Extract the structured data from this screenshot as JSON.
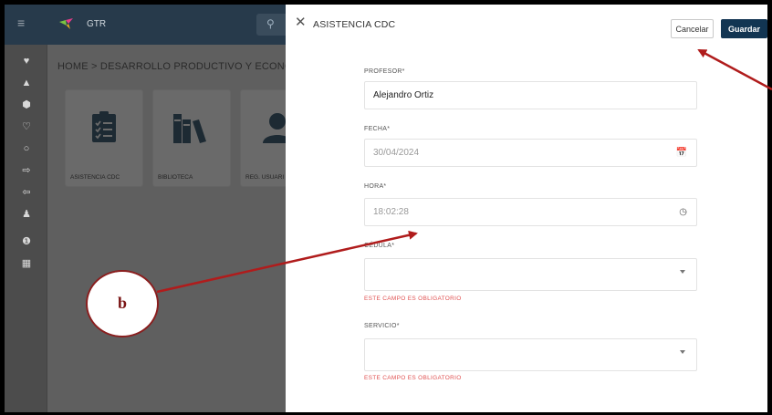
{
  "app": {
    "name": "GTR",
    "breadcrumb": "HOME  >  DESARROLLO PRODUCTIVO Y ECONC",
    "tiles": [
      {
        "label": "ASISTENCIA CDC",
        "icon": "clipboard-list-icon"
      },
      {
        "label": "BIBLIOTECA",
        "icon": "books-icon"
      },
      {
        "label": "REG. USUARI",
        "icon": "user-icon"
      }
    ],
    "rail_icons": [
      "heart-icon",
      "triangle-icon",
      "hexagon-icon",
      "bell-icon",
      "circle-icon",
      "arrow-right-icon",
      "arrow-left-icon",
      "person-icon",
      "info-icon",
      "grid-icon"
    ]
  },
  "panel": {
    "title": "ASISTENCIA CDC",
    "cancel_label": "Cancelar",
    "save_label": "Guardar",
    "fields": {
      "profesor": {
        "label": "PROFESOR*",
        "value": "Alejandro Ortiz"
      },
      "fecha": {
        "label": "FECHA*",
        "value": "30/04/2024",
        "icon": "calendar-icon"
      },
      "hora": {
        "label": "HORA*",
        "value": "18:02:28",
        "icon": "clock-icon"
      },
      "cedula": {
        "label": "CÉDULA*",
        "value": "",
        "error": "ESTE CAMPO ES OBLIGATORIO"
      },
      "servicio": {
        "label": "SERVICIO*",
        "value": "",
        "error": "ESTE CAMPO ES OBLIGATORIO"
      }
    }
  },
  "annotation": {
    "label": "b",
    "color": "#b01c1c"
  }
}
